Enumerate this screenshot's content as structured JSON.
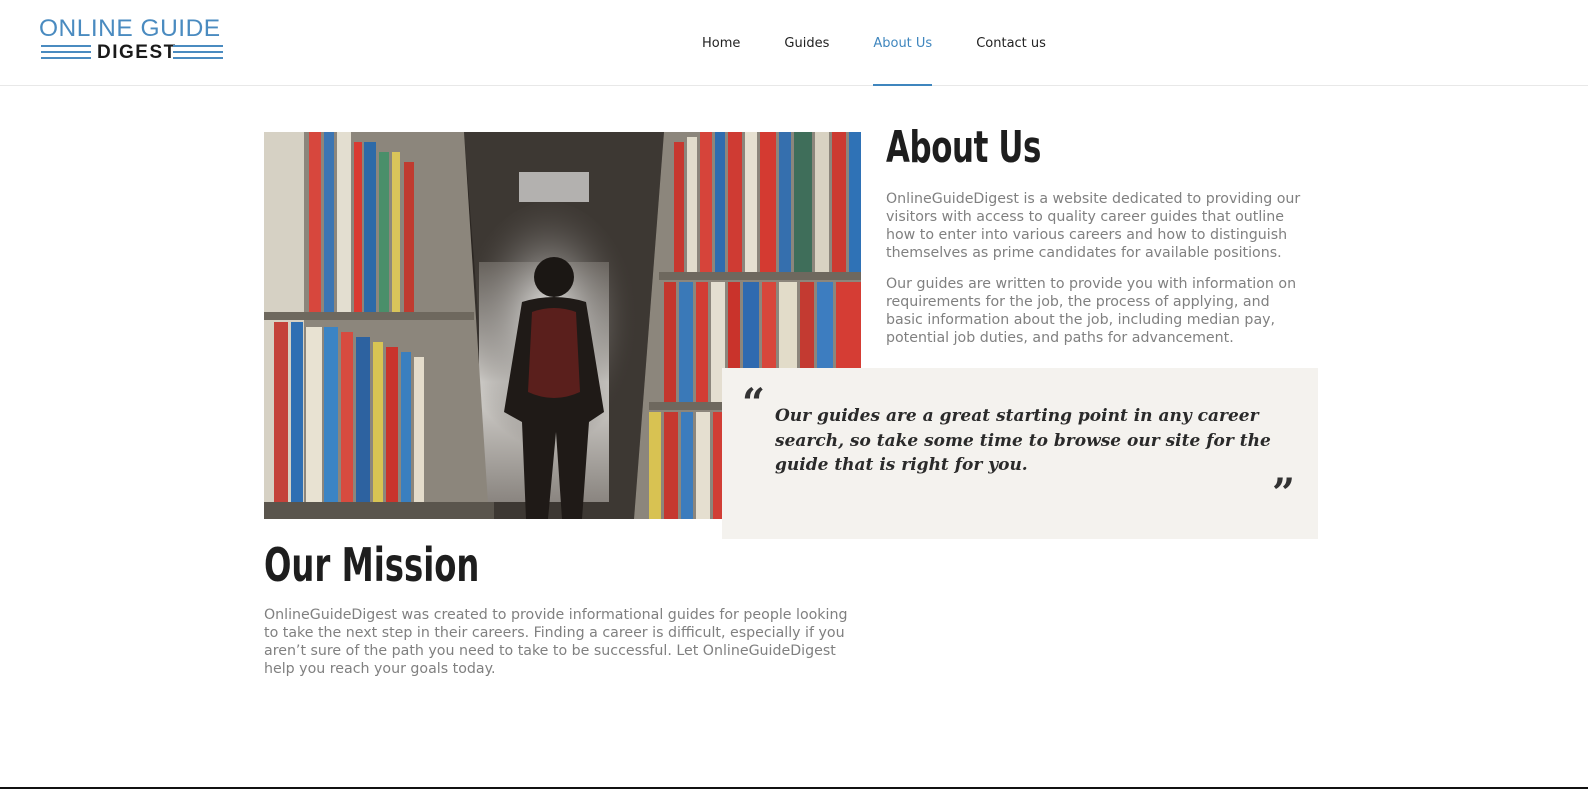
{
  "logo": {
    "line1": "ONLINE GUIDE",
    "line2": "DIGEST",
    "color": "#4a8bc0"
  },
  "nav": {
    "items": [
      {
        "label": "Home"
      },
      {
        "label": "Guides"
      },
      {
        "label": "About Us"
      },
      {
        "label": "Contact us"
      }
    ],
    "active": "About Us",
    "accent": "#3f86be"
  },
  "about": {
    "title": "About Us",
    "p1": "OnlineGuideDigest is a website dedicated to providing our visitors with access to quality career guides that outline how to enter into various careers and how to distinguish themselves as prime candidates for available positions.",
    "p2": "Our guides are written to provide you with information on requirements for the job, the process of applying, and basic information about the job, including median pay, potential job duties, and paths for advancement."
  },
  "quote": {
    "open": "“",
    "text": "Our guides are a great starting point in any career search, so take some time to browse our site for the guide that is right for you.",
    "close": "”"
  },
  "mission": {
    "title": "Our Mission",
    "text": "OnlineGuideDigest was created to provide informational guides for people looking to take the next step in their careers. Finding a career is difficult, especially if you aren’t sure of the path you need to take to be successful. Let OnlineGuideDigest help you reach your goals today."
  }
}
